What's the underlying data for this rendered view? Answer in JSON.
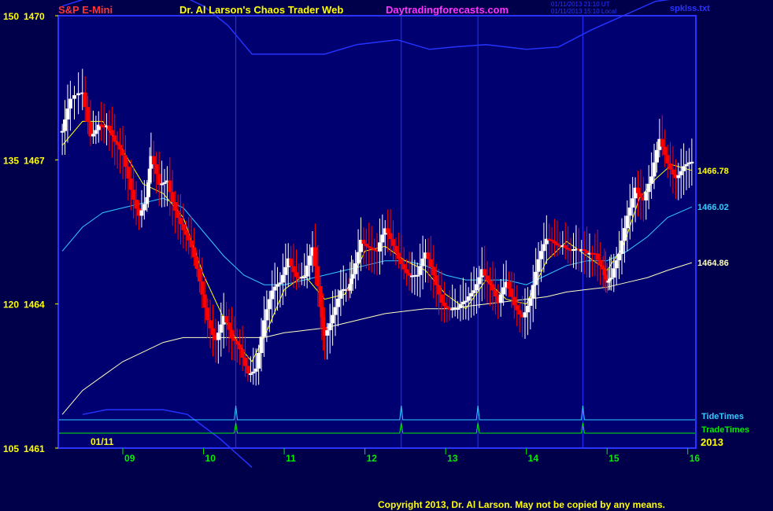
{
  "header": {
    "symbol": "S&P E-Mini",
    "title": "Dr. Al Larson's Chaos Trader Web",
    "site": "Daytradingforecasts.com",
    "stamp_line1": "01/11/2013 21:10 UT",
    "stamp_line2": "01/11/2013 15:10 Local",
    "file": "spklss.txt"
  },
  "footer": {
    "copyright": "Copyright 2013, Dr. Al Larson. May not be copied by any means."
  },
  "colors": {
    "background": "#00004a",
    "plot_bg": "#000070",
    "frame": "#2a33ff",
    "up_bar": "#ffffff",
    "down_bar": "#ff0000",
    "ema_fast": "#ffff00",
    "ema_mid": "#33ccff",
    "ema_slow": "#ffffc0",
    "envelope": "#2233ff",
    "tide": "#33ccff",
    "trade": "#00ee00",
    "title_red": "#ff3333",
    "title_yellow": "#ffff00",
    "title_magenta": "#ff33ff",
    "tick_green": "#00ee00"
  },
  "chart_data": {
    "type": "candlestick",
    "x_unit": "hour (CT)",
    "x_range": [
      8.2,
      16.1
    ],
    "y_range": [
      1461,
      1470
    ],
    "y_ticks": [
      {
        "value": 1470,
        "left": "150",
        "right": "1470"
      },
      {
        "value": 1467,
        "left": "135",
        "right": "1467"
      },
      {
        "value": 1464,
        "left": "120",
        "right": "1464"
      },
      {
        "value": 1461,
        "left": "105",
        "right": "1461"
      }
    ],
    "x_ticks": [
      {
        "value": 9,
        "label": "09"
      },
      {
        "value": 10,
        "label": "10"
      },
      {
        "value": 11,
        "label": "11"
      },
      {
        "value": 12,
        "label": "12"
      },
      {
        "value": 13,
        "label": "13"
      },
      {
        "value": 14,
        "label": "14"
      },
      {
        "value": 15,
        "label": "15"
      },
      {
        "value": 16,
        "label": "16"
      }
    ],
    "date_label": "01/11",
    "year_label": "2013",
    "vertical_markers": [
      10.4,
      12.45,
      13.4,
      14.7
    ],
    "ema_labels": [
      {
        "series": "ema_fast",
        "value": 1466.78,
        "label": "1466.78"
      },
      {
        "series": "ema_mid",
        "value": 1466.02,
        "label": "1466.02"
      },
      {
        "series": "ema_slow",
        "value": 1464.86,
        "label": "1464.86"
      }
    ],
    "close_path": [
      [
        8.25,
        1467.6
      ],
      [
        8.35,
        1468.1
      ],
      [
        8.5,
        1468.3
      ],
      [
        8.6,
        1467.6
      ],
      [
        8.7,
        1467.9
      ],
      [
        8.8,
        1467.7
      ],
      [
        8.9,
        1467.2
      ],
      [
        9.0,
        1467.0
      ],
      [
        9.1,
        1466.5
      ],
      [
        9.2,
        1466.0
      ],
      [
        9.3,
        1466.2
      ],
      [
        9.35,
        1466.9
      ],
      [
        9.45,
        1466.4
      ],
      [
        9.55,
        1466.7
      ],
      [
        9.65,
        1466.1
      ],
      [
        9.75,
        1465.5
      ],
      [
        9.85,
        1465.0
      ],
      [
        9.95,
        1464.4
      ],
      [
        10.05,
        1463.8
      ],
      [
        10.15,
        1463.4
      ],
      [
        10.25,
        1463.7
      ],
      [
        10.35,
        1463.1
      ],
      [
        10.45,
        1463.0
      ],
      [
        10.55,
        1462.7
      ],
      [
        10.65,
        1462.8
      ],
      [
        10.75,
        1463.6
      ],
      [
        10.85,
        1464.1
      ],
      [
        10.95,
        1464.4
      ],
      [
        11.05,
        1465.1
      ],
      [
        11.15,
        1464.7
      ],
      [
        11.25,
        1464.5
      ],
      [
        11.35,
        1465.0
      ],
      [
        11.45,
        1463.9
      ],
      [
        11.5,
        1463.5
      ],
      [
        11.6,
        1463.9
      ],
      [
        11.7,
        1464.2
      ],
      [
        11.8,
        1464.1
      ],
      [
        11.85,
        1464.6
      ],
      [
        11.95,
        1465.5
      ],
      [
        12.05,
        1465.3
      ],
      [
        12.15,
        1465.0
      ],
      [
        12.25,
        1465.4
      ],
      [
        12.35,
        1465.2
      ],
      [
        12.45,
        1465.0
      ],
      [
        12.55,
        1464.7
      ],
      [
        12.65,
        1464.5
      ],
      [
        12.75,
        1464.9
      ],
      [
        12.85,
        1464.6
      ],
      [
        12.95,
        1464.2
      ],
      [
        13.05,
        1464.0
      ],
      [
        13.15,
        1463.8
      ],
      [
        13.25,
        1463.9
      ],
      [
        13.35,
        1464.3
      ],
      [
        13.45,
        1464.9
      ],
      [
        13.55,
        1464.5
      ],
      [
        13.65,
        1463.9
      ],
      [
        13.75,
        1464.3
      ],
      [
        13.85,
        1464.0
      ],
      [
        13.95,
        1463.9
      ],
      [
        14.05,
        1464.2
      ],
      [
        14.15,
        1464.8
      ],
      [
        14.25,
        1465.2
      ],
      [
        14.35,
        1465.3
      ],
      [
        14.45,
        1465.4
      ],
      [
        14.55,
        1465.2
      ],
      [
        14.65,
        1465.0
      ],
      [
        14.75,
        1464.9
      ],
      [
        14.85,
        1465.1
      ],
      [
        14.95,
        1464.9
      ],
      [
        15.0,
        1464.5
      ],
      [
        15.05,
        1464.4
      ],
      [
        15.15,
        1464.9
      ],
      [
        15.25,
        1465.9
      ],
      [
        15.35,
        1466.6
      ],
      [
        15.45,
        1466.2
      ],
      [
        15.55,
        1466.5
      ],
      [
        15.65,
        1467.3
      ],
      [
        15.75,
        1467.0
      ],
      [
        15.85,
        1466.8
      ],
      [
        15.95,
        1466.9
      ],
      [
        16.05,
        1466.8
      ]
    ],
    "ema_fast_path": [
      [
        8.25,
        1467.3
      ],
      [
        8.5,
        1467.8
      ],
      [
        8.75,
        1467.8
      ],
      [
        9.0,
        1467.2
      ],
      [
        9.25,
        1466.5
      ],
      [
        9.5,
        1466.3
      ],
      [
        9.75,
        1465.8
      ],
      [
        10.0,
        1464.6
      ],
      [
        10.25,
        1463.7
      ],
      [
        10.5,
        1463.0
      ],
      [
        10.6,
        1462.8
      ],
      [
        10.8,
        1463.5
      ],
      [
        11.0,
        1464.3
      ],
      [
        11.25,
        1464.6
      ],
      [
        11.5,
        1464.1
      ],
      [
        11.75,
        1464.2
      ],
      [
        12.0,
        1465.1
      ],
      [
        12.25,
        1465.2
      ],
      [
        12.5,
        1464.9
      ],
      [
        12.75,
        1464.7
      ],
      [
        13.0,
        1464.2
      ],
      [
        13.25,
        1463.9
      ],
      [
        13.5,
        1464.5
      ],
      [
        13.75,
        1464.1
      ],
      [
        14.0,
        1464.0
      ],
      [
        14.25,
        1464.9
      ],
      [
        14.5,
        1465.3
      ],
      [
        14.75,
        1465.0
      ],
      [
        15.0,
        1464.7
      ],
      [
        15.2,
        1465.2
      ],
      [
        15.4,
        1466.2
      ],
      [
        15.6,
        1466.6
      ],
      [
        15.8,
        1466.9
      ],
      [
        16.05,
        1466.78
      ]
    ],
    "ema_mid_path": [
      [
        8.25,
        1465.1
      ],
      [
        8.5,
        1465.6
      ],
      [
        8.75,
        1465.9
      ],
      [
        9.0,
        1466.0
      ],
      [
        9.25,
        1466.1
      ],
      [
        9.5,
        1466.2
      ],
      [
        9.75,
        1466.0
      ],
      [
        10.0,
        1465.5
      ],
      [
        10.25,
        1465.0
      ],
      [
        10.5,
        1464.6
      ],
      [
        10.75,
        1464.4
      ],
      [
        11.0,
        1464.4
      ],
      [
        11.25,
        1464.5
      ],
      [
        11.5,
        1464.6
      ],
      [
        11.75,
        1464.7
      ],
      [
        12.0,
        1464.8
      ],
      [
        12.25,
        1464.9
      ],
      [
        12.5,
        1464.9
      ],
      [
        12.75,
        1464.8
      ],
      [
        13.0,
        1464.6
      ],
      [
        13.25,
        1464.5
      ],
      [
        13.5,
        1464.5
      ],
      [
        13.75,
        1464.5
      ],
      [
        14.0,
        1464.4
      ],
      [
        14.25,
        1464.6
      ],
      [
        14.5,
        1464.8
      ],
      [
        14.75,
        1464.9
      ],
      [
        15.0,
        1464.9
      ],
      [
        15.25,
        1465.1
      ],
      [
        15.5,
        1465.4
      ],
      [
        15.75,
        1465.8
      ],
      [
        16.05,
        1466.02
      ]
    ],
    "ema_slow_path": [
      [
        8.25,
        1461.7
      ],
      [
        8.5,
        1462.2
      ],
      [
        8.75,
        1462.5
      ],
      [
        9.0,
        1462.8
      ],
      [
        9.25,
        1463.0
      ],
      [
        9.5,
        1463.2
      ],
      [
        9.75,
        1463.3
      ],
      [
        10.0,
        1463.3
      ],
      [
        10.25,
        1463.3
      ],
      [
        10.5,
        1463.3
      ],
      [
        10.75,
        1463.3
      ],
      [
        11.0,
        1463.4
      ],
      [
        11.25,
        1463.45
      ],
      [
        11.5,
        1463.5
      ],
      [
        11.75,
        1463.6
      ],
      [
        12.0,
        1463.7
      ],
      [
        12.25,
        1463.8
      ],
      [
        12.5,
        1463.85
      ],
      [
        12.75,
        1463.9
      ],
      [
        13.0,
        1463.9
      ],
      [
        13.25,
        1463.95
      ],
      [
        13.5,
        1464.0
      ],
      [
        13.75,
        1464.05
      ],
      [
        14.0,
        1464.1
      ],
      [
        14.25,
        1464.15
      ],
      [
        14.5,
        1464.25
      ],
      [
        14.75,
        1464.3
      ],
      [
        15.0,
        1464.35
      ],
      [
        15.25,
        1464.45
      ],
      [
        15.5,
        1464.55
      ],
      [
        15.75,
        1464.7
      ],
      [
        16.05,
        1464.86
      ]
    ],
    "envelope_upper": [
      [
        8.25,
        1470.2
      ],
      [
        9.0,
        1470.6
      ],
      [
        9.5,
        1470.6
      ],
      [
        10.0,
        1470.2
      ],
      [
        10.3,
        1469.8
      ],
      [
        10.6,
        1469.2
      ],
      [
        11.0,
        1469.2
      ],
      [
        11.5,
        1469.2
      ],
      [
        11.9,
        1469.4
      ],
      [
        12.4,
        1469.5
      ],
      [
        12.8,
        1469.3
      ],
      [
        13.1,
        1469.35
      ],
      [
        13.5,
        1469.4
      ],
      [
        14.0,
        1469.3
      ],
      [
        14.4,
        1469.35
      ],
      [
        14.8,
        1469.7
      ],
      [
        15.2,
        1470.0
      ],
      [
        15.6,
        1470.3
      ],
      [
        16.05,
        1470.4
      ]
    ],
    "envelope_lower": [
      [
        8.5,
        1461.7
      ],
      [
        8.8,
        1461.8
      ],
      [
        9.2,
        1461.8
      ],
      [
        9.5,
        1461.8
      ],
      [
        9.8,
        1461.7
      ],
      [
        10.2,
        1461.2
      ],
      [
        10.6,
        1460.6
      ]
    ],
    "tide_label": "TideTimes",
    "trade_label": "TradeTimes"
  }
}
